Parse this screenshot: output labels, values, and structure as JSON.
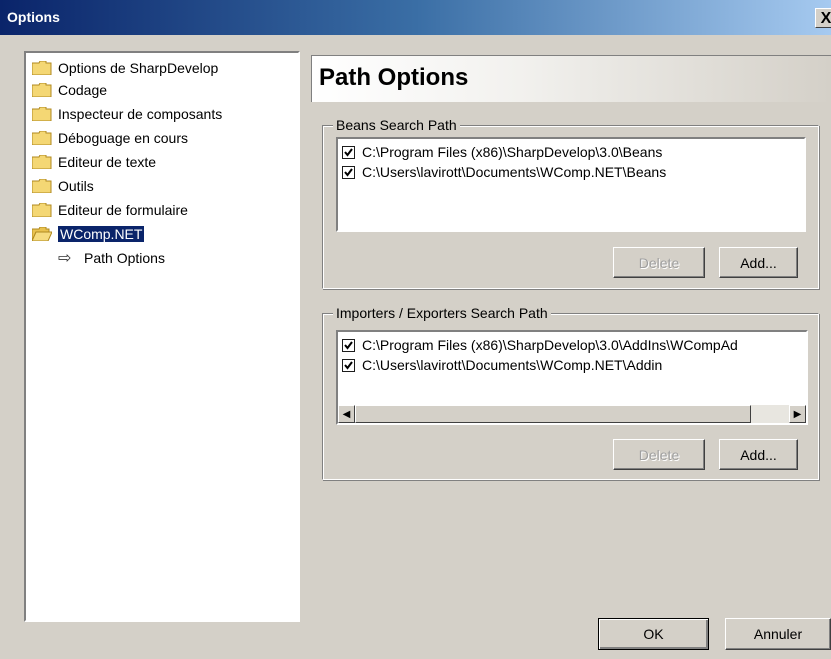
{
  "window": {
    "title": "Options",
    "close_glyph": "X"
  },
  "tree": {
    "items": [
      {
        "label": "Options de SharpDevelop",
        "icon": "folder-closed-icon"
      },
      {
        "label": "Codage",
        "icon": "folder-closed-icon"
      },
      {
        "label": "Inspecteur de composants",
        "icon": "folder-closed-icon"
      },
      {
        "label": "Déboguage en cours",
        "icon": "folder-closed-icon"
      },
      {
        "label": "Editeur de texte",
        "icon": "folder-closed-icon"
      },
      {
        "label": "Outils",
        "icon": "folder-closed-icon"
      },
      {
        "label": "Editeur de formulaire",
        "icon": "folder-closed-icon"
      },
      {
        "label": "WComp.NET",
        "icon": "folder-open-icon",
        "selected": true
      }
    ],
    "child": {
      "label": "Path Options",
      "icon": "arrow-right-icon"
    }
  },
  "panel": {
    "title": "Path Options"
  },
  "beans": {
    "label": "Beans Search Path",
    "paths": [
      {
        "path": "C:\\Program Files (x86)\\SharpDevelop\\3.0\\Beans",
        "checked": true
      },
      {
        "path": "C:\\Users\\lavirott\\Documents\\WComp.NET\\Beans",
        "checked": true
      }
    ],
    "delete_label": "Delete",
    "add_label": "Add..."
  },
  "importers": {
    "label": "Importers / Exporters Search Path",
    "paths": [
      {
        "path": "C:\\Program Files (x86)\\SharpDevelop\\3.0\\AddIns\\WCompAd",
        "checked": true
      },
      {
        "path": "C:\\Users\\lavirott\\Documents\\WComp.NET\\Addin",
        "checked": true
      }
    ],
    "delete_label": "Delete",
    "add_label": "Add..."
  },
  "footer": {
    "ok_label": "OK",
    "cancel_label": "Annuler"
  },
  "colors": {
    "selection": "#0a246a",
    "dialog_bg": "#d4d0c8",
    "title_gradient_start": "#0a246a"
  }
}
